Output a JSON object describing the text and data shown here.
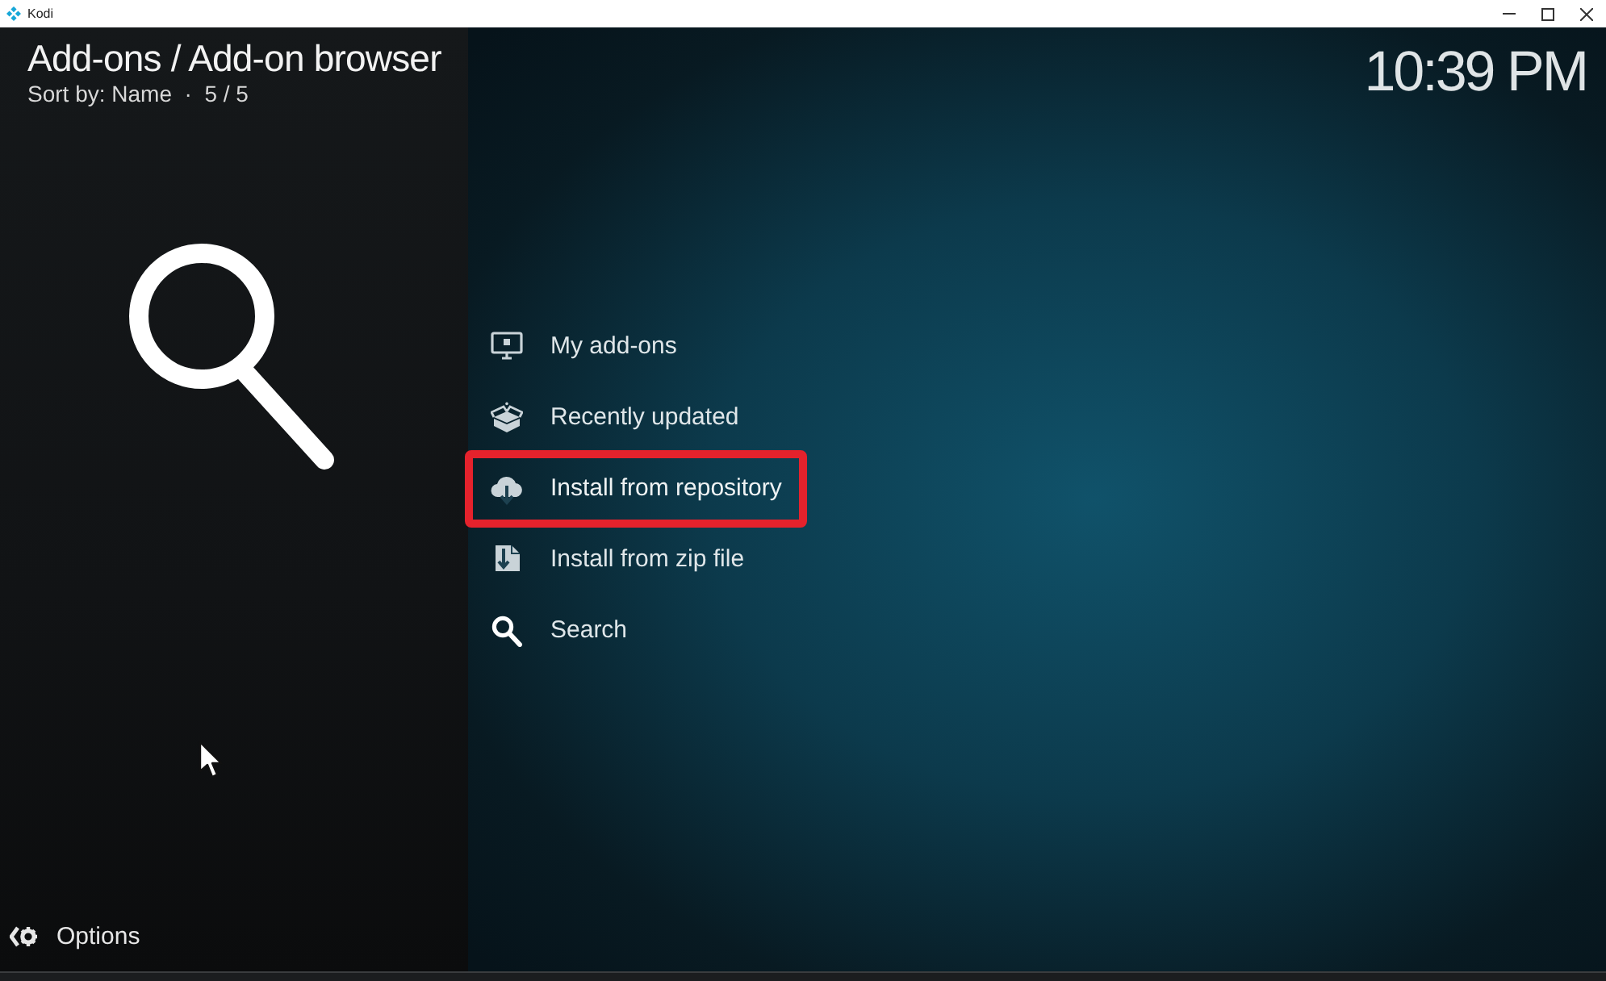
{
  "window": {
    "title": "Kodi"
  },
  "header": {
    "title": "Add-ons / Add-on browser",
    "subtitle": "Sort by: Name  ·  5 / 5",
    "clock": "10:39 PM"
  },
  "menu": [
    {
      "kind": "monitor",
      "label": "My add-ons",
      "selected": false
    },
    {
      "kind": "box",
      "label": "Recently updated",
      "selected": false
    },
    {
      "kind": "cloud",
      "label": "Install from repository",
      "selected": true
    },
    {
      "kind": "zip",
      "label": "Install from zip file",
      "selected": false
    },
    {
      "kind": "search",
      "label": "Search",
      "selected": false
    }
  ],
  "options": {
    "label": "Options"
  }
}
